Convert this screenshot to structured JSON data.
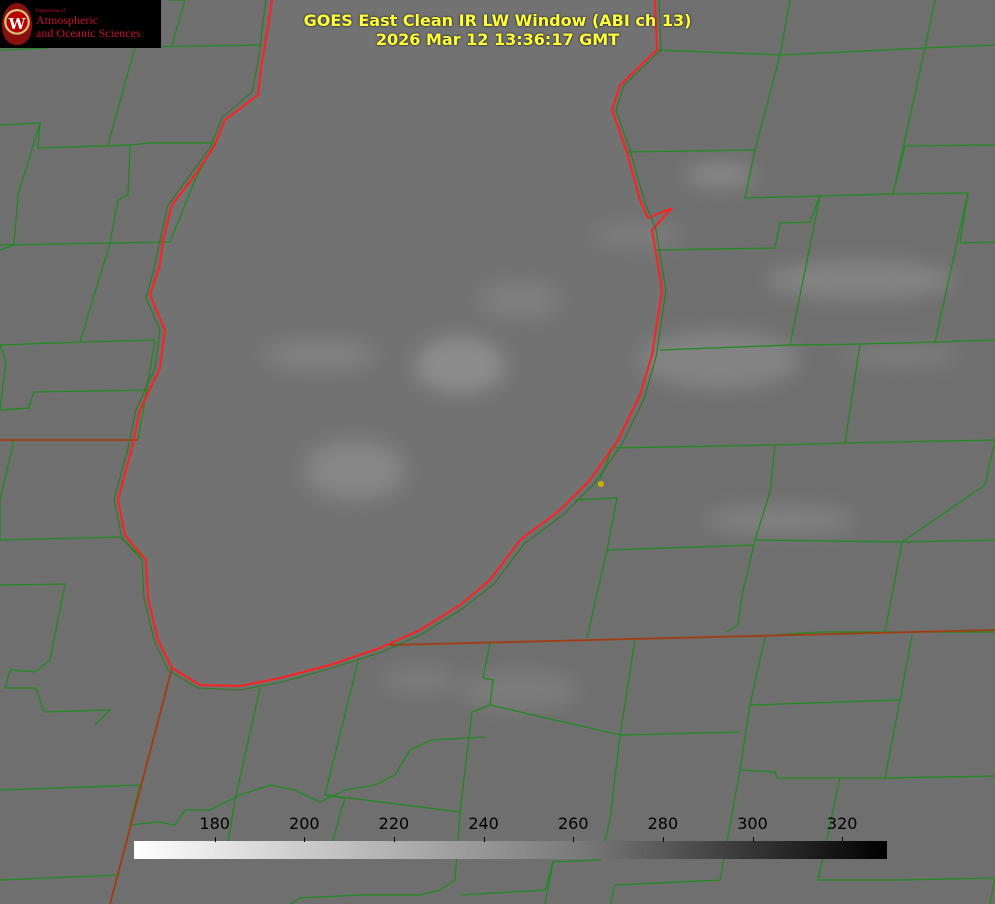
{
  "header": {
    "title_line1": "GOES East Clean IR LW Window (ABI ch 13)",
    "title_line2": "2026 Mar 12 13:36:17 GMT"
  },
  "logo": {
    "seal_letter": "W",
    "department_small": "Department of",
    "line1": "Atmospheric",
    "line2": "and Oceanic Sciences"
  },
  "colorbar": {
    "labels": [
      "180",
      "200",
      "220",
      "240",
      "260",
      "280",
      "300",
      "320"
    ],
    "min_value": 162,
    "max_value": 330
  },
  "colors": {
    "county_lines": "#1f8a1f",
    "shoreline": "#ff2020",
    "title_text": "#ffff3a",
    "city_marker": "#c8b400"
  }
}
